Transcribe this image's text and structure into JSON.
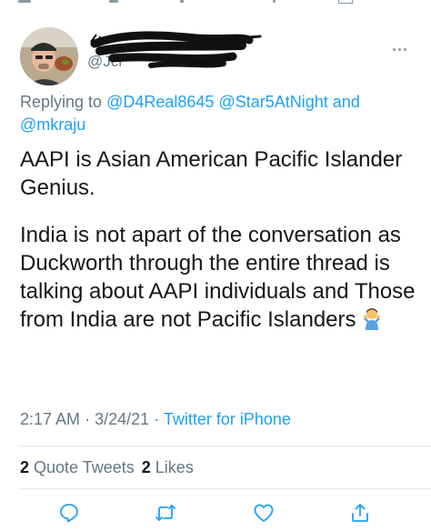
{
  "tweet": {
    "handle": "@Jcr",
    "replying_prefix": "Replying to",
    "mention_1": "@D4Real8645",
    "mention_2": "@Star5AtNight",
    "and_word": "and",
    "mention_3": "@mkraju",
    "paragraph_1": "AAPI is Asian American Pacific Islander Genius.",
    "paragraph_2": "India is not apart of the conversation as Duckworth through the entire thread is talking about AAPI individuals and Those from India are not Pacific Islanders",
    "emoji": "person-shrugging",
    "time": "2:17 AM",
    "date": "3/24/21",
    "source": "Twitter for iPhone",
    "dot": "·",
    "quote_count": "2",
    "quote_label": "Quote Tweets",
    "like_count": "2",
    "like_label": "Likes"
  },
  "icons": {
    "reply": "reply-icon",
    "retweet": "retweet-icon",
    "like": "heart-icon",
    "share": "share-icon",
    "more": "more-icon"
  },
  "colors": {
    "link": "#1da1f2",
    "secondary": "#657786",
    "text": "#14171a",
    "divider": "#e1e8ed"
  }
}
